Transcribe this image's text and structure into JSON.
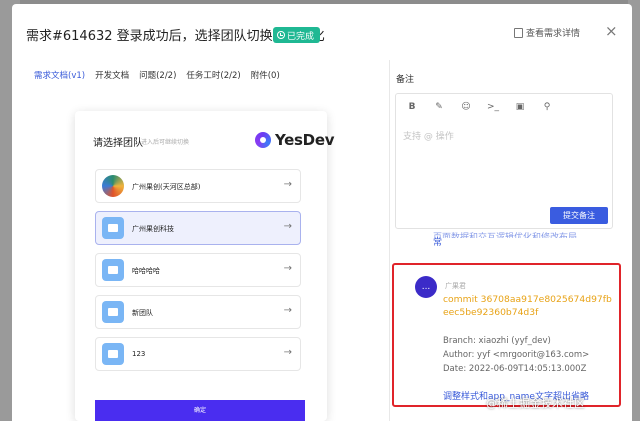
{
  "header": {
    "title": "需求#614632  登录成功后，选择团队切换交互优化",
    "status": "已完成",
    "view_detail": "查看需求详情",
    "close": "×"
  },
  "tabs": [
    "需求文档(v1)",
    "开发文档",
    "问题(2/2)",
    "任务工时(2/2)",
    "附件(0)"
  ],
  "preview": {
    "title": "请选择团队",
    "subtitle": "进入后可继续切换",
    "logo": "YesDev",
    "teams": [
      {
        "name": "广州果创(天河区总部)",
        "icon": "globe-logo-icon"
      },
      {
        "name": "广州果创科技",
        "icon": "briefcase-icon"
      },
      {
        "name": "哈哈哈哈",
        "icon": "briefcase-icon"
      },
      {
        "name": "新团队",
        "icon": "briefcase-icon"
      },
      {
        "name": "123",
        "icon": "briefcase-icon"
      }
    ],
    "confirm": "确定"
  },
  "notes": {
    "title": "备注",
    "toolbar": [
      "B",
      "✎",
      "☺",
      ">_",
      "▣",
      "⚲"
    ],
    "placeholder": "支持 @ 操作",
    "submit": "提交备注",
    "trunc_top": "页面数据和交互逻辑优化和修改布局",
    "trunc_tail": "常"
  },
  "comment": {
    "avatar": "...",
    "author": "广果君",
    "body": "commit 36708aa917e8025674d97fbeec5be92360b74d3f",
    "branch": "Branch: xiaozhi (yyf_dev)",
    "author_line": "Author: yyf <mrgoorit@163.com>",
    "date": "Date: 2022-06-09T14:05:13.000Z",
    "next": "调整样式和app_name文字超出省略"
  },
  "watermark": "@稀土掘金技术社区"
}
